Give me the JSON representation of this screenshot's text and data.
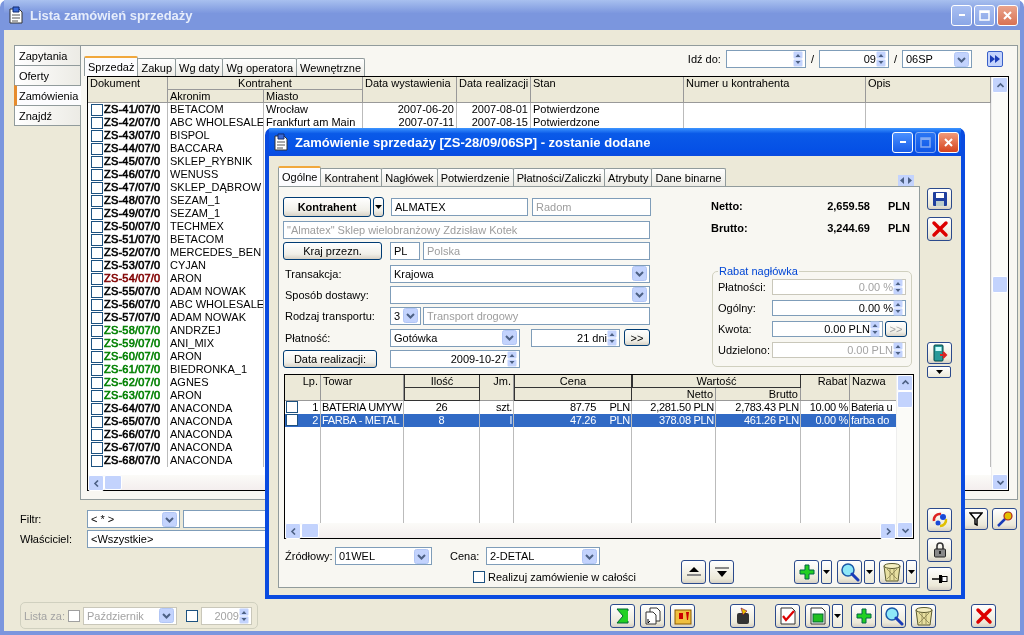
{
  "window": {
    "title": "Lista zamówień sprzedaży"
  },
  "side_tabs": [
    {
      "label": "Zapytania",
      "selected": false
    },
    {
      "label": "Oferty",
      "selected": false
    },
    {
      "label": "Zamówienia",
      "selected": true
    },
    {
      "label": "Znajdź",
      "selected": false
    }
  ],
  "tabs": [
    {
      "label": "Sprzedaż",
      "selected": true
    },
    {
      "label": "Zakup",
      "selected": false
    },
    {
      "label": "Wg daty",
      "selected": false
    },
    {
      "label": "Wg operatora",
      "selected": false
    },
    {
      "label": "Wewnętrzne",
      "selected": false
    }
  ],
  "goto": {
    "label": "Idź do:",
    "separator_1": "/",
    "month": "09",
    "separator_2": "/",
    "series": "06SP"
  },
  "list": {
    "columns": {
      "dokument": "Dokument",
      "kontrahent": "Kontrahent",
      "akronim": "Akronim",
      "miasto": "Miasto",
      "data_wystawienia": "Data wystawienia",
      "data_realizacji": "Data realizacji",
      "stan": "Stan",
      "numer": "Numer u kontrahenta",
      "opis": "Opis"
    },
    "rows": [
      {
        "document": "ZS-41/07/0",
        "checked": false,
        "color": "#000000",
        "akronim": "BETACOM",
        "miasto": "Wrocław",
        "issued": "2007-06-20",
        "due": "2007-08-01",
        "status": "Potwierdzone"
      },
      {
        "document": "ZS-42/07/0",
        "checked": false,
        "color": "#000000",
        "akronim": "ABC WHOLESALE",
        "miasto": "Frankfurt am Main",
        "issued": "2007-07-11",
        "due": "2007-08-15",
        "status": "Potwierdzone"
      },
      {
        "document": "ZS-43/07/0",
        "checked": false,
        "color": "#000000",
        "akronim": "BISPOL"
      },
      {
        "document": "ZS-44/07/0",
        "checked": false,
        "color": "#000000",
        "akronim": "BACCARA"
      },
      {
        "document": "ZS-45/07/0",
        "checked": false,
        "color": "#000000",
        "akronim": "SKLEP_RYBNIK"
      },
      {
        "document": "ZS-46/07/0",
        "checked": false,
        "color": "#000000",
        "akronim": "WENUSS"
      },
      {
        "document": "ZS-47/07/0",
        "checked": false,
        "color": "#000000",
        "akronim": "SKLEP_DĄBROW"
      },
      {
        "document": "ZS-48/07/0",
        "checked": false,
        "color": "#000000",
        "akronim": "SEZAM_1"
      },
      {
        "document": "ZS-49/07/0",
        "checked": false,
        "color": "#000000",
        "akronim": "SEZAM_1"
      },
      {
        "document": "ZS-50/07/0",
        "checked": false,
        "color": "#000000",
        "akronim": "TECHMEX"
      },
      {
        "document": "ZS-51/07/0",
        "checked": false,
        "color": "#000000",
        "akronim": "BETACOM"
      },
      {
        "document": "ZS-52/07/0",
        "checked": false,
        "color": "#000000",
        "akronim": "MERCEDES_BEN"
      },
      {
        "document": "ZS-53/07/0",
        "checked": false,
        "color": "#000000",
        "akronim": "CYJAN"
      },
      {
        "document": "ZS-54/07/0",
        "checked": false,
        "color": "#800000",
        "akronim": "ARON"
      },
      {
        "document": "ZS-55/07/0",
        "checked": false,
        "color": "#000000",
        "akronim": "ADAM NOWAK"
      },
      {
        "document": "ZS-56/07/0",
        "checked": false,
        "color": "#000000",
        "akronim": "ABC WHOLESALE"
      },
      {
        "document": "ZS-57/07/0",
        "checked": false,
        "color": "#000000",
        "akronim": "ADAM NOWAK"
      },
      {
        "document": "ZS-58/07/0",
        "checked": false,
        "color": "#008000",
        "akronim": "ANDRZEJ"
      },
      {
        "document": "ZS-59/07/0",
        "checked": false,
        "color": "#008000",
        "akronim": "ANI_MIX"
      },
      {
        "document": "ZS-60/07/0",
        "checked": false,
        "color": "#008000",
        "akronim": "ARON"
      },
      {
        "document": "ZS-61/07/0",
        "checked": false,
        "color": "#008000",
        "akronim": "BIEDRONKA_1"
      },
      {
        "document": "ZS-62/07/0",
        "checked": false,
        "color": "#008000",
        "akronim": "AGNES"
      },
      {
        "document": "ZS-63/07/0",
        "checked": false,
        "color": "#008000",
        "akronim": "ARON"
      },
      {
        "document": "ZS-64/07/0",
        "checked": false,
        "color": "#000000",
        "akronim": "ANACONDA"
      },
      {
        "document": "ZS-65/07/0",
        "checked": false,
        "color": "#000000",
        "akronim": "ANACONDA"
      },
      {
        "document": "ZS-66/07/0",
        "checked": false,
        "color": "#000000",
        "akronim": "ANACONDA"
      },
      {
        "document": "ZS-67/07/0",
        "checked": false,
        "color": "#000000",
        "akronim": "ANACONDA"
      },
      {
        "document": "ZS-68/07/0",
        "checked": false,
        "color": "#000000",
        "akronim": "ANACONDA"
      }
    ]
  },
  "filter": {
    "label": "Filtr:",
    "value": "< * >"
  },
  "owner": {
    "label": "Właściciel:",
    "value": "<Wszystkie>"
  },
  "list_for": {
    "label": "Lista za:",
    "disabled": true,
    "month_checked": false,
    "month": "Październik",
    "year_checked": false,
    "year": "2009"
  },
  "dialog": {
    "title": "Zamówienie sprzedaży [ZS-28/09/06SP] - zostanie dodane",
    "maximize_disabled": true,
    "tabs": [
      {
        "label": "Ogólne",
        "selected": true
      },
      {
        "label": "Kontrahent",
        "selected": false
      },
      {
        "label": "Nagłówek",
        "selected": false
      },
      {
        "label": "Potwierdzenie",
        "selected": false
      },
      {
        "label": "Płatności/Zaliczki",
        "selected": false
      },
      {
        "label": "Atrybuty",
        "selected": false
      },
      {
        "label": "Dane binarne",
        "selected": false
      }
    ],
    "contractor": {
      "button": "Kontrahent",
      "code": "ALMATEX",
      "city": "Radom",
      "full_name": "\"Almatex\" Sklep wielobranżowy Zdzisław Kotek"
    },
    "country": {
      "button": "Kraj przezn.",
      "code": "PL",
      "name": "Polska"
    },
    "transaction": {
      "label": "Transakcja:",
      "value": "Krajowa"
    },
    "delivery": {
      "label": "Sposób dostawy:"
    },
    "transport": {
      "label": "Rodzaj transportu:",
      "code": "3",
      "name": "Transport drogowy"
    },
    "payment": {
      "label": "Płatność:",
      "value": "Gotówka",
      "term": "21 dni",
      "more": ">>"
    },
    "due_date": {
      "button": "Data realizacji:",
      "value": "2009-10-27"
    },
    "totals": [
      {
        "label": "Netto:",
        "value": "2,659.58",
        "currency": "PLN"
      },
      {
        "label": "Brutto:",
        "value": "3,244.69",
        "currency": "PLN"
      }
    ],
    "discount": {
      "title": "Rabat nagłówka",
      "rows": [
        {
          "label": "Płatności:",
          "value": "0.00 %",
          "disabled": true
        },
        {
          "label": "Ogólny:",
          "value": "0.00 %",
          "disabled": false
        },
        {
          "label": "Kwota:",
          "value": "0.00 PLN",
          "disabled": false,
          "more": ">>",
          "more_disabled": true
        },
        {
          "label": "Udzielono:",
          "value": "0.00 PLN",
          "disabled": true
        }
      ]
    },
    "items": {
      "columns": {
        "lp": "Lp.",
        "towar": "Towar",
        "ilosc": "Ilość",
        "jm": "Jm.",
        "cena": "Cena",
        "wartosc": "Wartość",
        "netto": "Netto",
        "brutto": "Brutto",
        "rabat": "Rabat",
        "nazwa": "Nazwa"
      },
      "rows": [
        {
          "checked": false,
          "selected": false,
          "lp": "1",
          "towar": "BATERIA UMYW",
          "ilosc": "26",
          "jm": "szt.",
          "cena": "87.75",
          "currency": "PLN",
          "netto": "2,281.50 PLN",
          "brutto": "2,783.43 PLN",
          "rabat": "10.00 %",
          "nazwa": "Bateria u"
        },
        {
          "checked": false,
          "selected": true,
          "lp": "2",
          "towar": "FARBA - METAL",
          "ilosc": "8",
          "jm": "l",
          "cena": "47.26",
          "currency": "PLN",
          "netto": "378.08 PLN",
          "brutto": "461.26 PLN",
          "rabat": "0.00 %",
          "nazwa": "farba do"
        }
      ]
    },
    "source": {
      "label": "Źródłowy:",
      "value": "01WEL"
    },
    "price": {
      "label": "Cena:",
      "value": "2-DETAL"
    },
    "complete": {
      "label": "Realizuj zamówienie w całości",
      "checked": false
    }
  }
}
